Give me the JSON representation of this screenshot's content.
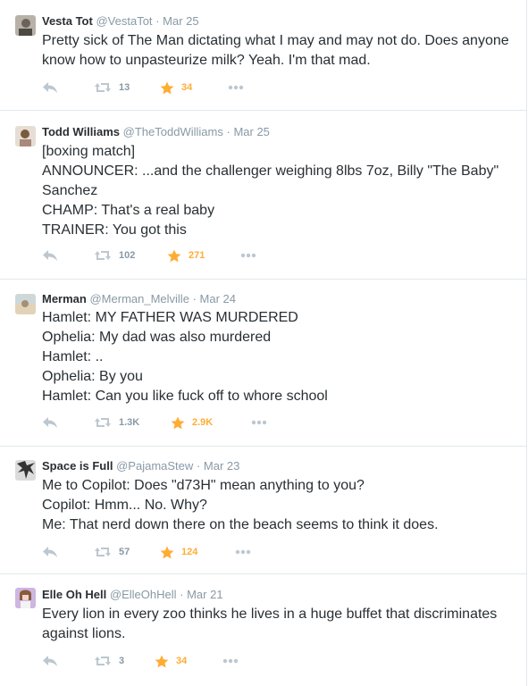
{
  "colors": {
    "muted": "#8899a6",
    "favorite": "#ffac33",
    "text": "#292f33",
    "divider": "#e1e8ed"
  },
  "icons": {
    "reply": "reply-arrow-icon",
    "retweet": "retweet-icon",
    "favorite": "star-icon",
    "more": "more-dots-icon"
  },
  "tweets": [
    {
      "name": "Vesta Tot",
      "handle": "@VestaTot",
      "separator": "·",
      "time": "Mar 25",
      "lines": [
        "Pretty sick of The Man dictating what I may and may not do. Does anyone",
        "know how to unpasteurize milk? Yeah. I'm that mad."
      ],
      "retweets": "13",
      "favorites": "34"
    },
    {
      "name": "Todd Williams",
      "handle": "@TheToddWilliams",
      "separator": "·",
      "time": "Mar 25",
      "lines": [
        "[boxing match]",
        "ANNOUNCER: ...and the challenger weighing 8lbs 7oz, Billy \"The Baby\"",
        "Sanchez",
        "CHAMP: That's a real baby",
        "TRAINER: You got this"
      ],
      "retweets": "102",
      "favorites": "271"
    },
    {
      "name": "Merman",
      "handle": "@Merman_Melville",
      "separator": "·",
      "time": "Mar 24",
      "lines": [
        "Hamlet: MY FATHER WAS MURDERED",
        "Ophelia: My dad was also murdered",
        "Hamlet: ..",
        "Ophelia: By you",
        "Hamlet: Can you like fuck off to whore school"
      ],
      "retweets": "1.3K",
      "favorites": "2.9K"
    },
    {
      "name": "Space is Full",
      "handle": "@PajamaStew",
      "separator": "·",
      "time": "Mar 23",
      "lines": [
        "Me to Copilot: Does \"d73H\" mean anything to you?",
        "Copilot: Hmm... No. Why?",
        "Me: That nerd down there on the beach seems to think it does."
      ],
      "retweets": "57",
      "favorites": "124"
    },
    {
      "name": "Elle Oh Hell",
      "handle": "@ElleOhHell",
      "separator": "·",
      "time": "Mar 21",
      "lines": [
        "Every lion in every zoo thinks he lives in a huge buffet that discriminates",
        "against lions."
      ],
      "retweets": "3",
      "favorites": "34"
    }
  ]
}
